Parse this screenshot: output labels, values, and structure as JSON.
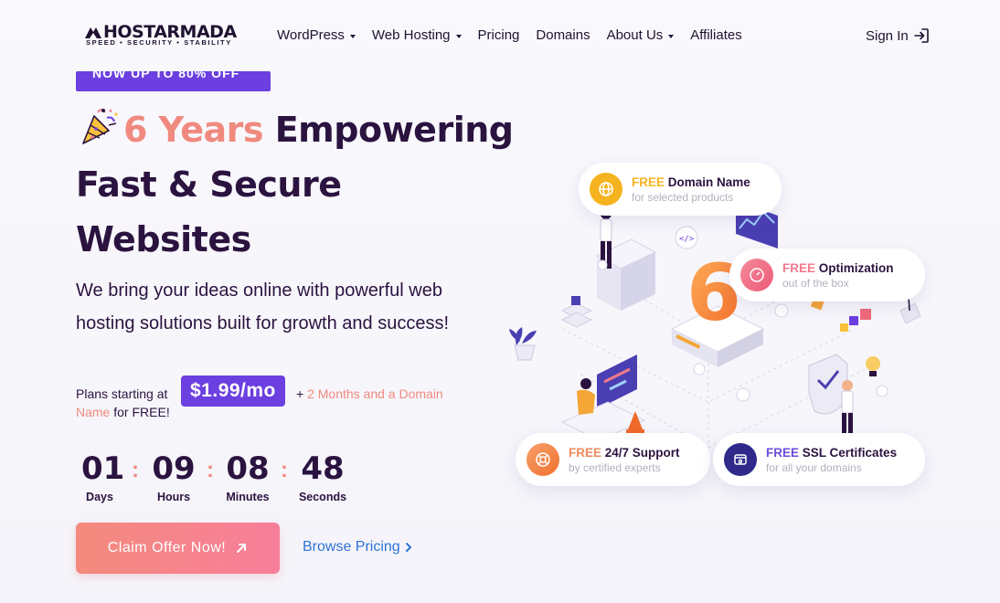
{
  "header": {
    "logo_text": "HOSTARMADA",
    "logo_tagline": "SPEED • SECURITY • STABILITY",
    "nav": [
      {
        "label": "WordPress",
        "dropdown": true
      },
      {
        "label": "Web Hosting",
        "dropdown": true
      },
      {
        "label": "Pricing",
        "dropdown": false
      },
      {
        "label": "Domains",
        "dropdown": false
      },
      {
        "label": "About Us",
        "dropdown": true
      },
      {
        "label": "Affiliates",
        "dropdown": false
      }
    ],
    "signin_label": "Sign In"
  },
  "promo": {
    "text": "NOW UP TO 80% OFF"
  },
  "hero": {
    "title_highlight": "6 Years",
    "title_rest_1": " Empowering",
    "title_line_2": "Fast & Secure",
    "title_line_3": "Websites",
    "subtitle": "We bring your ideas online with powerful web hosting solutions built for growth and success!"
  },
  "plans": {
    "starting_label": "Plans starting at",
    "price": "$1.99/mo",
    "plus": "+",
    "bonus_part1": "2 Months and a Domain",
    "bonus_part2": "Name",
    "for_free": "for FREE!"
  },
  "countdown": [
    {
      "value": "01",
      "label": "Days"
    },
    {
      "value": "09",
      "label": "Hours"
    },
    {
      "value": "08",
      "label": "Minutes"
    },
    {
      "value": "48",
      "label": "Seconds"
    }
  ],
  "countdown_sep": ":",
  "cta": {
    "claim_label": "Claim Offer Now!",
    "browse_label": "Browse Pricing"
  },
  "features": [
    {
      "free": "FREE",
      "title": "Domain Name",
      "sub": "for selected products",
      "icon": "globe-icon"
    },
    {
      "free": "FREE",
      "title": "Optimization",
      "sub": "out of the box",
      "icon": "speedometer-icon"
    },
    {
      "free": "FREE",
      "title": "24/7 Support",
      "sub": "by certified experts",
      "icon": "lifebuoy-icon"
    },
    {
      "free": "FREE",
      "title": "SSL Certificates",
      "sub": "for all your domains",
      "icon": "ssl-lock-icon"
    }
  ],
  "illustration": {
    "big_number": "6"
  },
  "colors": {
    "brand_purple": "#6b3fe0",
    "accent_coral": "#f08a7f",
    "link_blue": "#2d73d6",
    "heading": "#2b1340"
  }
}
